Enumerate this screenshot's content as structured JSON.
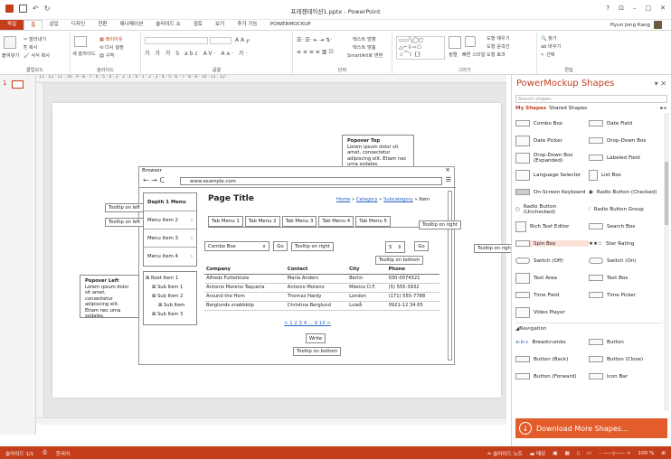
{
  "window": {
    "title": "프레젠테이션1.pptx - PowerPoint",
    "controls": [
      "?",
      "⊡",
      "–",
      "□",
      "✕"
    ]
  },
  "tabs": [
    "파일",
    "홈",
    "삽입",
    "디자인",
    "전환",
    "애니메이션",
    "슬라이드 쇼",
    "검토",
    "보기",
    "추가 기능",
    "POWERMOCKUP"
  ],
  "user": "Hyun Jong Kang",
  "ribbon": {
    "groups": [
      "클립보드",
      "슬라이드",
      "글꼴",
      "단락",
      "그리기",
      "편집"
    ],
    "clipboard": {
      "paste": "붙여넣기",
      "cut": "잘라내기",
      "copy": "복사",
      "format": "서식 복사"
    },
    "slides": {
      "new": "새 슬라이드",
      "layout": "레이아웃",
      "reset": "다시 설정",
      "section": "구역"
    },
    "paragraph": {
      "text_dir": "텍스트 방향",
      "align_text": "텍스트 맞춤",
      "smartart": "SmartArt로 변환"
    },
    "drawing": {
      "arrange": "정렬",
      "quick_styles": "빠른 스타일",
      "fill": "도형 채우기",
      "outline": "도형 윤곽선",
      "effects": "도형 효과"
    },
    "editing": {
      "find": "찾기",
      "replace": "바꾸기",
      "select": "선택"
    }
  },
  "slide_number": "1",
  "ruler_text": "· 13 · 12 · 11 · 10 · 9 · 8 · 7 · 6 · 5 · 4 · 3 · 2 · 1 · 0 · 1 · 2 · 3 · 4 · 5 · 6 · 7 · 8 · 9 · 10 · 11 · 12 ·",
  "status": {
    "slide": "슬라이드 1/1",
    "lang": "한국어",
    "notes": "슬라이드 노트",
    "comments": "메모",
    "zoom": "100 %"
  },
  "panel": {
    "title": "PowerMockup Shapes",
    "search_placeholder": "Search shapes",
    "tab_my": "My Shapes",
    "tab_shared": "Shared Shapes",
    "rows": [
      [
        "Combo Box",
        "Date Field"
      ],
      [
        "Date Picker",
        "Drop-Down Box"
      ],
      [
        "Drop-Down Box (Expanded)",
        "Labeled Field"
      ],
      [
        "Language Selector",
        "List Box"
      ],
      [
        "On-Screen Keyboard",
        "Radio Button (Checked)"
      ],
      [
        "Radio Button (Unchecked)",
        "Radio Button Group"
      ],
      [
        "Rich Text Editor",
        "Search Box"
      ],
      [
        "Spin Box",
        "Star Rating"
      ],
      [
        "Switch (Off)",
        "Switch (On)"
      ],
      [
        "Text Area",
        "Text Box"
      ],
      [
        "Time Field",
        "Time Picker"
      ],
      [
        "Video Player",
        ""
      ]
    ],
    "section": "Navigation",
    "nav_rows": [
      [
        "Breadcrumbs",
        "Button"
      ],
      [
        "Button (Back)",
        "Button (Close)"
      ],
      [
        "Button (Forward)",
        "Icon Bar"
      ]
    ],
    "download": "Download More Shapes..."
  },
  "mockup": {
    "browser_title": "Browser",
    "url": "www.example.com",
    "popover_top": {
      "title": "Popover Top",
      "body": "Lorem ipsum dolor sit amet, consectetur adipiscing elit. Etiam nec urna sodales."
    },
    "popover_left": {
      "title": "Popover Left",
      "body": "Lorem ipsum dolor sit amet, consectetur adipiscing elit. Etiam nec urna sodales."
    },
    "menu": [
      "Depth 1 Menu",
      "Menu Item 2",
      "Menu Item 3",
      "Menu Item 4"
    ],
    "tooltip_left": "Tooltip on left",
    "tooltip_right": "Tooltip on right",
    "tooltip_bottom": "Tooltip on bottom",
    "page_title": "Page Title",
    "breadcrumb": [
      "Home",
      "Category",
      "Subcategory",
      "Item"
    ],
    "tabs": [
      "Tab Menu 1",
      "Tab Menu 2",
      "Tab Menu 3",
      "Tab Menu 4",
      "Tab Menu 5"
    ],
    "combo": "Combo Box",
    "go": "Go",
    "spin": "5",
    "table_headers": [
      "Company",
      "Contact",
      "City",
      "Phone"
    ],
    "table_rows": [
      [
        "Alfreds Futterkiste",
        "Maria Anders",
        "Berlin",
        "030-0074321"
      ],
      [
        "Antonio Moreno Taquería",
        "Antonio Moreno",
        "México D.F.",
        "(5) 555-3932"
      ],
      [
        "Around the Horn",
        "Thomas Hardy",
        "London",
        "(171) 555-7788"
      ],
      [
        "Berglunds snabbköp",
        "Christina Berglund",
        "Luleå",
        "0921-12 34 65"
      ]
    ],
    "tree": [
      "Root Item 1",
      "Sub Item 1",
      "Sub Item 2",
      "Sub Item",
      "Sub Item 3"
    ],
    "pagination": "< 1 2 3 4 ... 9 10 >",
    "write": "Write"
  }
}
